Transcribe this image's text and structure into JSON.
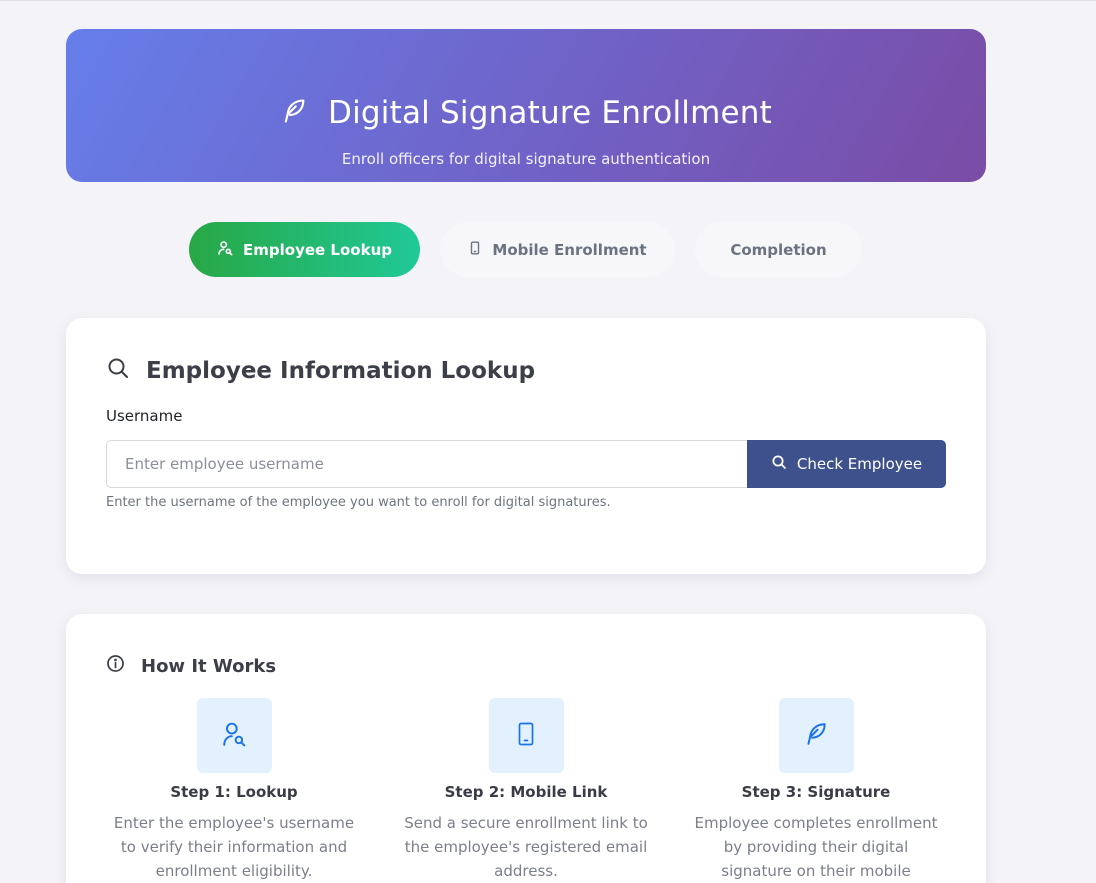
{
  "header": {
    "title": "Digital Signature Enrollment",
    "subtitle": "Enroll officers for digital signature authentication",
    "icon": "feather-icon"
  },
  "wizard": {
    "steps": [
      {
        "label": "Employee Lookup",
        "icon": "user-search-icon",
        "active": true
      },
      {
        "label": "Mobile Enrollment",
        "icon": "mobile-icon",
        "active": false
      },
      {
        "label": "Completion",
        "active": false
      }
    ]
  },
  "lookup": {
    "heading": "Employee Information Lookup",
    "username_label": "Username",
    "username_value": "",
    "username_placeholder": "Enter employee username",
    "check_button": "Check Employee",
    "help_text": "Enter the username of the employee you want to enroll for digital signatures."
  },
  "how_it_works": {
    "heading": "How It Works",
    "steps": [
      {
        "title": "Step 1: Lookup",
        "desc": "Enter the employee's username to verify their information and enrollment eligibility.",
        "icon": "user-search-icon"
      },
      {
        "title": "Step 2: Mobile Link",
        "desc": "Send a secure enrollment link to the employee's registered email address.",
        "icon": "mobile-icon"
      },
      {
        "title": "Step 3: Signature",
        "desc": "Employee completes enrollment by providing their digital signature on their mobile",
        "icon": "feather-icon"
      }
    ]
  },
  "colors": {
    "hero_gradient_start": "#667eea",
    "hero_gradient_end": "#764ba2",
    "active_step_start": "#28a745",
    "active_step_end": "#20c997",
    "primary_button": "#3f518c",
    "step_icon_color": "#1a73e8",
    "step_icon_bg": "#e3f0fd"
  }
}
